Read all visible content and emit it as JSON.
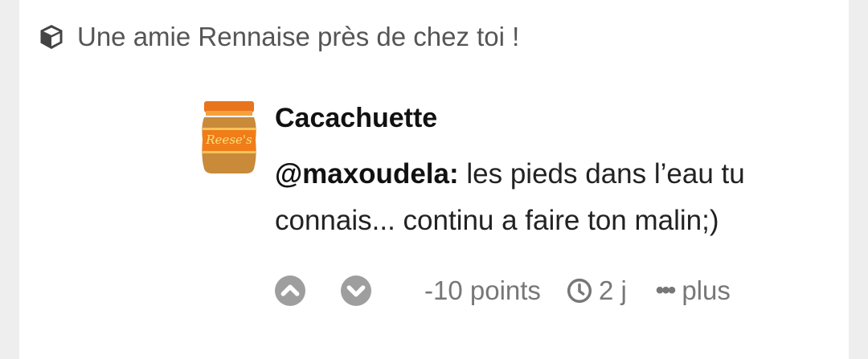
{
  "topic": {
    "icon": "cube-icon",
    "title": "Une amie Rennaise près de chez toi !"
  },
  "comment": {
    "author": "Cacachuette",
    "avatar_label": "Reese's",
    "mention": "@maxoudela:",
    "text": " les pieds dans l’eau tu connais... continu a faire ton malin;)"
  },
  "actions": {
    "upvote_icon": "upvote-icon",
    "downvote_icon": "downvote-icon",
    "points": "-10 points",
    "time": "2 j",
    "more_label": "plus",
    "more_dots": "•••"
  },
  "colors": {
    "background": "#eeeeee",
    "card": "#ffffff",
    "muted": "#777777",
    "icon_gray": "#9e9e9e"
  }
}
